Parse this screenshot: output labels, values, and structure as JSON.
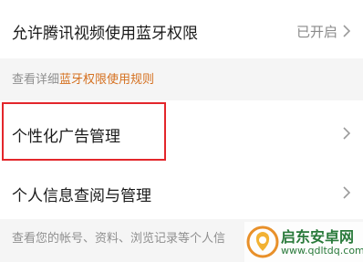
{
  "rows": {
    "bluetooth": {
      "label": "允许腾讯视频使用蓝牙权限",
      "value": "已开启"
    },
    "ads": {
      "label": "个性化广告管理"
    },
    "personal_info": {
      "label": "个人信息查阅与管理"
    }
  },
  "descriptions": {
    "bluetooth_prefix": "查看详细",
    "bluetooth_link": "蓝牙权限使用规则",
    "personal_info": "查看您的帐号、资料、浏览记录等个人信"
  },
  "watermark": {
    "title": "启东安卓网",
    "url": "www.qdltdq.com"
  },
  "icons": {
    "chevron": "chevron-right-icon",
    "logo": "watermark-logo-icon"
  },
  "colors": {
    "link": "#d5701f",
    "highlight": "#e3262b",
    "watermark": "#2a7a3b"
  }
}
